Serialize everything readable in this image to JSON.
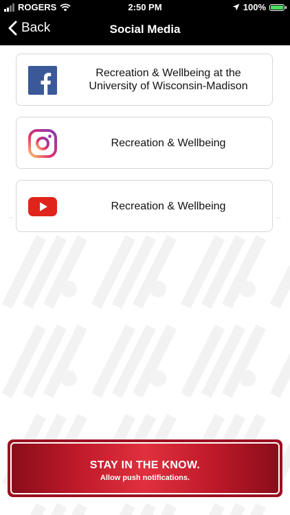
{
  "status": {
    "carrier": "ROGERS",
    "time": "2:50 PM",
    "battery": "100%"
  },
  "nav": {
    "back_label": "Back",
    "title": "Social Media"
  },
  "items": [
    {
      "label": "Recreation & Wellbeing at the University of Wisconsin-Madison",
      "icon": "facebook-icon"
    },
    {
      "label": "Recreation & Wellbeing",
      "icon": "instagram-icon"
    },
    {
      "label": "Recreation & Wellbeing",
      "icon": "youtube-icon"
    }
  ],
  "banner": {
    "title": "STAY IN THE KNOW.",
    "subtitle": "Allow push notifications."
  },
  "colors": {
    "accent": "#c01a2a",
    "facebook": "#3b5998",
    "youtube": "#e0241b",
    "bar": "#000000"
  }
}
